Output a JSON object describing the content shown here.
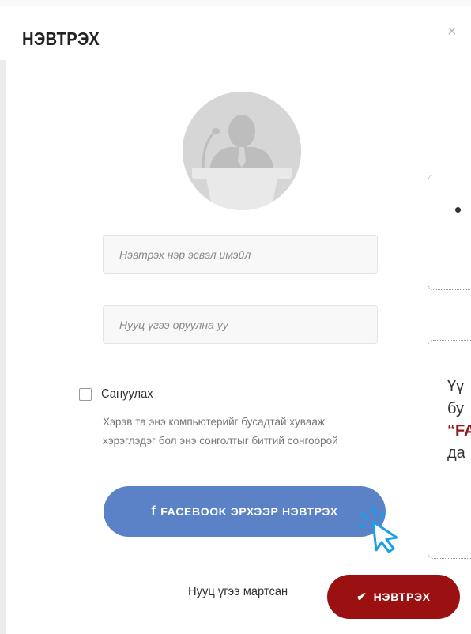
{
  "dialog": {
    "title": "НЭВТРЭХ",
    "close_glyph": "×"
  },
  "form": {
    "username_placeholder": "Нэвтрэх нэр эсвэл имэйл",
    "password_placeholder": "Нууц үгээ оруулна уу",
    "remember_label": "Сануулах",
    "remember_checked": false,
    "remember_hint": "Хэрэв та энэ компьютерийг бусадтай хувааж хэрэглэдэг бол энэ сонголтыг битгий сонгоорой",
    "facebook_button_label": "FACEBOOK ЭРХЭЭР НЭВТРЭХ",
    "forgot_password_label": "Нууц үгээ мартсан",
    "login_button_label": "НЭВТРЭХ"
  },
  "callouts": {
    "second_lines": [
      "Үү",
      "бу",
      "“FA",
      "да"
    ]
  },
  "colors": {
    "facebook_blue": "#5b82c6",
    "login_red": "#9b1111",
    "highlight_red": "#8c1a1a",
    "cursor_blue": "#1aa0e8"
  },
  "icons": {
    "avatar": "user-presenter-icon",
    "facebook": "facebook-f-icon",
    "login": "checkmark-icon",
    "cursor": "pointer-cursor-icon"
  }
}
